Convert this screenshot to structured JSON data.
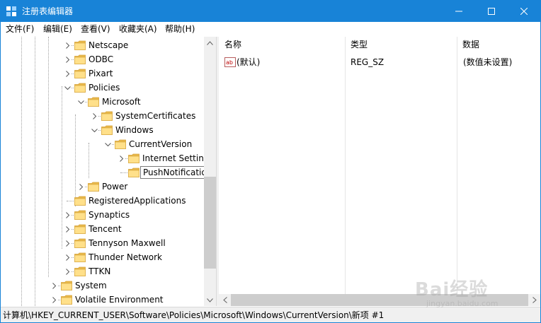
{
  "window": {
    "title": "注册表编辑器",
    "accent_color": "#1883d7",
    "controls": [
      "minimize-icon",
      "maximize-icon",
      "close-icon"
    ]
  },
  "menu": [
    "文件(F)",
    "编辑(E)",
    "查看(V)",
    "收藏夹(A)",
    "帮助(H)"
  ],
  "tree": [
    {
      "label": "Netscape",
      "expander": "collapsed"
    },
    {
      "label": "ODBC",
      "expander": "collapsed"
    },
    {
      "label": "Pixart",
      "expander": "collapsed"
    },
    {
      "label": "Policies",
      "expander": "expanded"
    },
    {
      "label": "Microsoft",
      "expander": "expanded"
    },
    {
      "label": "SystemCertificates",
      "expander": "collapsed"
    },
    {
      "label": "Windows",
      "expander": "expanded"
    },
    {
      "label": "CurrentVersion",
      "expander": "expanded"
    },
    {
      "label": "Internet Settings",
      "expander": "collapsed"
    },
    {
      "label": "PushNotifications",
      "expander": "none",
      "selected": true
    },
    {
      "label": "Power",
      "expander": "collapsed"
    },
    {
      "label": "RegisteredApplications",
      "expander": "none"
    },
    {
      "label": "Synaptics",
      "expander": "collapsed"
    },
    {
      "label": "Tencent",
      "expander": "collapsed"
    },
    {
      "label": "Tennyson Maxwell",
      "expander": "collapsed"
    },
    {
      "label": "Thunder Network",
      "expander": "collapsed"
    },
    {
      "label": "TTKN",
      "expander": "collapsed"
    },
    {
      "label": "System",
      "expander": "collapsed"
    },
    {
      "label": "Volatile Environment",
      "expander": "collapsed"
    }
  ],
  "list": {
    "columns": [
      "名称",
      "类型",
      "数据"
    ],
    "rows": [
      {
        "icon": "string-value-icon",
        "name": "(默认)",
        "type": "REG_SZ",
        "data": "(数值未设置)"
      }
    ]
  },
  "status": "计算机\\HKEY_CURRENT_USER\\Software\\Policies\\Microsoft\\Windows\\CurrentVersion\\新项 #1",
  "watermark": {
    "brand": "Bai经验",
    "url": "jingyan.baidu.com"
  }
}
